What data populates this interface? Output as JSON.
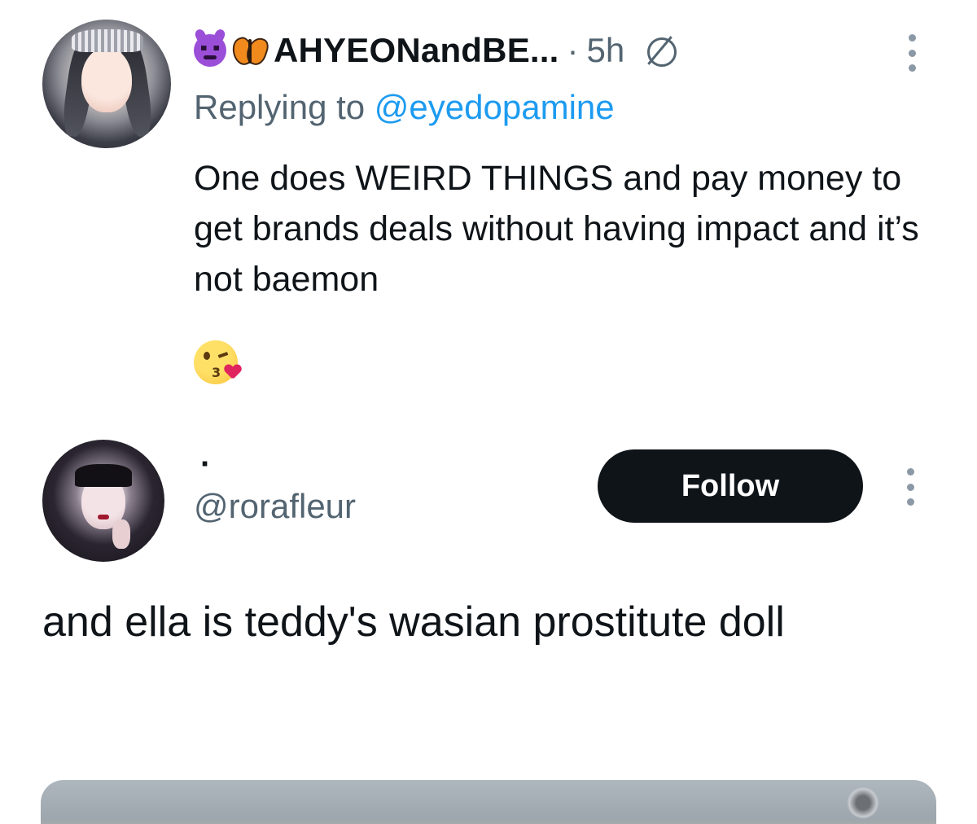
{
  "reply_tweet": {
    "display_name": "AHYEONandBE...",
    "name_emojis": [
      "smiling-devil-emoji",
      "butterfly-emoji"
    ],
    "time_separator": "·",
    "time": "5h",
    "replying_prefix": "Replying to",
    "replying_handle": "@eyedopamine",
    "text": "One does WEIRD THINGS and pay money to get brands deals without having impact and it’s not baemon",
    "trailing_emoji": "kissing-face-heart-emoji"
  },
  "quoted_tweet": {
    "display_name": "·",
    "handle": "@rorafleur",
    "follow_label": "Follow",
    "text": "and ella is teddy's wasian prostitute doll"
  },
  "colors": {
    "text_primary": "#0f1419",
    "text_secondary": "#536471",
    "link": "#1d9bf0",
    "button_bg": "#0f1419",
    "button_text": "#ffffff"
  },
  "icons": {
    "more": "more-vertical-icon",
    "no_reply": "slashed-circle-icon"
  }
}
